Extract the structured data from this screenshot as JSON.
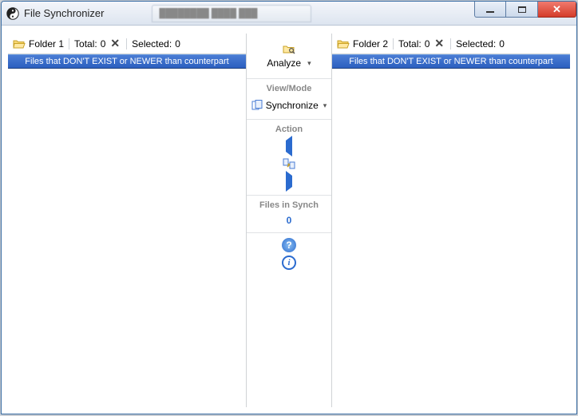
{
  "window": {
    "title": "File Synchronizer",
    "background_tab": "████████ ████ ███"
  },
  "left": {
    "folder_label": "Folder 1",
    "total_label": "Total:",
    "total_value": "0",
    "selected_label": "Selected:",
    "selected_value": "0",
    "bluebar": "Files that DON'T EXIST or NEWER than counterpart"
  },
  "right": {
    "folder_label": "Folder 2",
    "total_label": "Total:",
    "total_value": "0",
    "selected_label": "Selected:",
    "selected_value": "0",
    "bluebar": "Files that DON'T EXIST or NEWER than counterpart"
  },
  "middle": {
    "analyze_label": "Analyze",
    "viewmode_label": "View/Mode",
    "synchronize_label": "Synchronize",
    "action_label": "Action",
    "files_in_synch_label": "Files in Synch",
    "files_in_synch_value": "0"
  },
  "icons": {
    "app": "yin-yang-icon",
    "folder": "folder-open-icon",
    "clear": "x-icon",
    "analyze": "folder-search-icon",
    "synchronize": "pages-icon",
    "copy_left": "triangle-left-icon",
    "sync_both": "pages-swap-icon",
    "copy_right": "triangle-right-icon",
    "help": "help-icon",
    "info": "info-icon"
  }
}
